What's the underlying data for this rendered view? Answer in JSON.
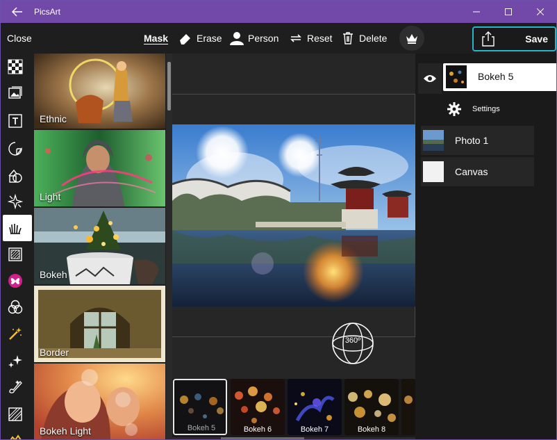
{
  "window": {
    "title": "PicsArt",
    "back_icon": "back-arrow-icon"
  },
  "toolbar": {
    "close_label": "Close",
    "mask_label": "Mask",
    "erase_label": "Erase",
    "person_label": "Person",
    "reset_label": "Reset",
    "delete_label": "Delete",
    "save_label": "Save"
  },
  "effects": [
    {
      "label": "Ethnic"
    },
    {
      "label": "Light"
    },
    {
      "label": "Bokeh"
    },
    {
      "label": "Border"
    },
    {
      "label": "Bokeh Light"
    }
  ],
  "canvas": {
    "view_360_label": "360º"
  },
  "bokeh_strip": [
    {
      "label": "Bokeh 5"
    },
    {
      "label": "Bokeh 6"
    },
    {
      "label": "Bokeh 7"
    },
    {
      "label": "Bokeh 8"
    }
  ],
  "layers": {
    "active": {
      "name": "Bokeh 5"
    },
    "settings_label": "Settings",
    "items": [
      {
        "name": "Photo 1"
      },
      {
        "name": "Canvas"
      }
    ]
  },
  "colors": {
    "titlebar": "#7248a8",
    "accent": "#2bb3c9",
    "panel": "#1e1e1e"
  }
}
